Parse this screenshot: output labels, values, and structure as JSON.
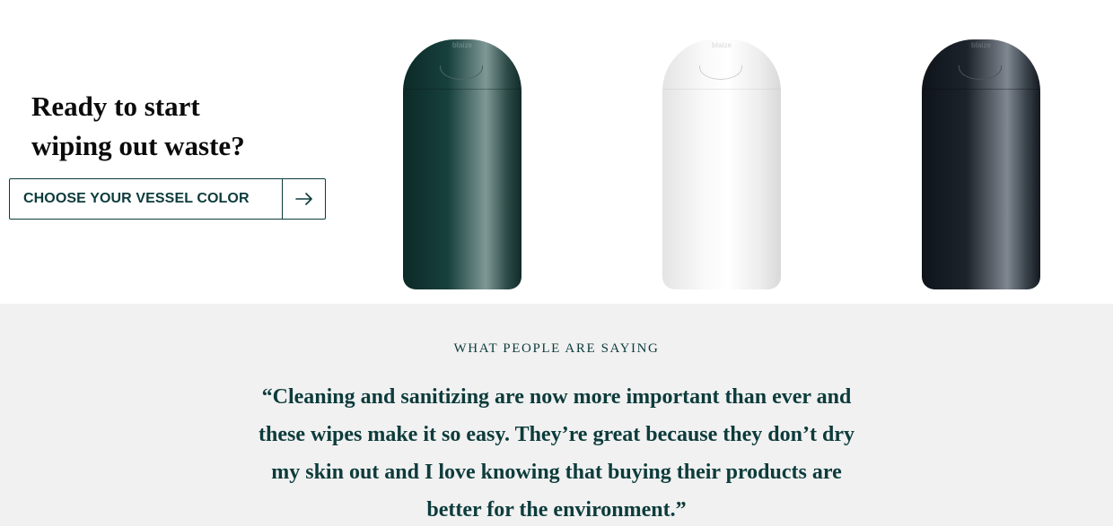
{
  "hero": {
    "headline_lines": [
      "Ready to start",
      "wiping out waste?"
    ],
    "cta": {
      "label": "CHOOSE YOUR VESSEL COLOR",
      "icon": "arrow-right-icon"
    },
    "vessels": [
      {
        "color_name": "green",
        "color": "#17403c",
        "brand_mark": "blaize"
      },
      {
        "color_name": "white",
        "color": "#f5f5f5",
        "brand_mark": "blaize"
      },
      {
        "color_name": "black",
        "color": "#1c232b",
        "brand_mark": "blaize"
      }
    ]
  },
  "testimonials": {
    "eyebrow": "WHAT PEOPLE ARE SAYING",
    "quote_lines": [
      "“Cleaning and sanitizing are now more important than ever and",
      "these wipes make it so easy. They’re great because they don’t dry",
      "my skin out and I love knowing that buying their products are",
      "better for the environment.”"
    ]
  },
  "colors": {
    "accent": "#0d3b3b",
    "section_bg": "#f1f1f1",
    "page_bg": "#ffffff"
  }
}
